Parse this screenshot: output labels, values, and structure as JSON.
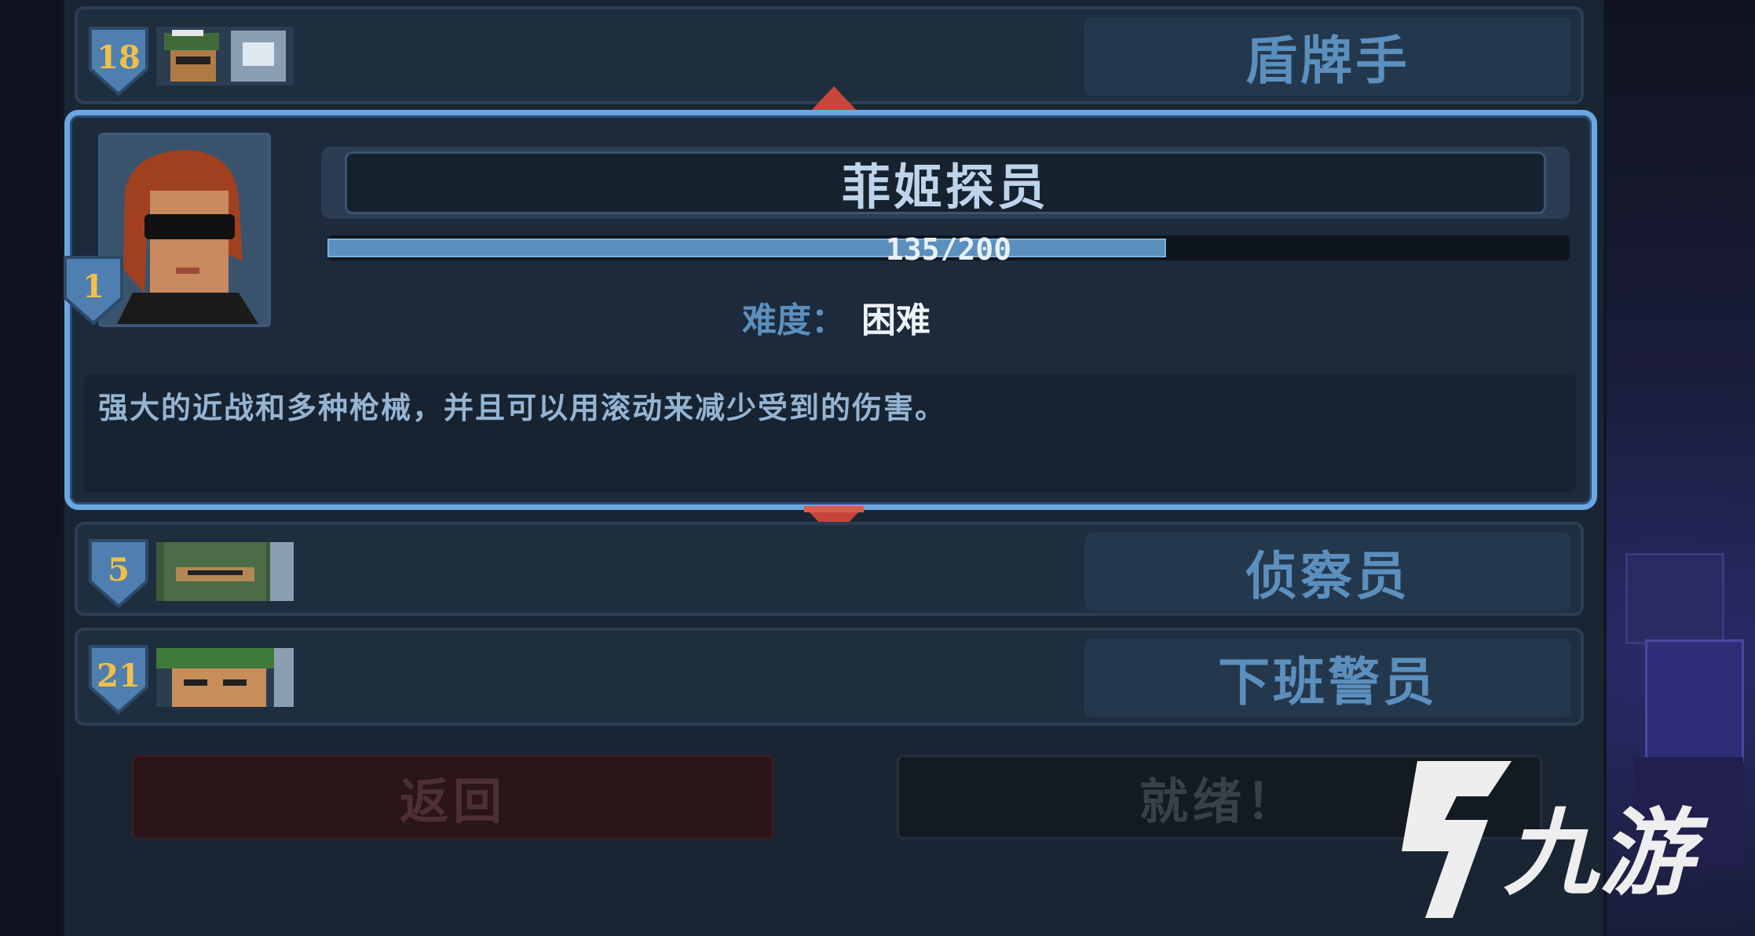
{
  "roster": [
    {
      "level": "18",
      "name": "盾牌手"
    },
    {
      "level": "5",
      "name": "侦察员"
    },
    {
      "level": "21",
      "name": "下班警员"
    }
  ],
  "selected": {
    "level": "1",
    "name": "菲姬探员",
    "xp_text": "135/200",
    "xp_fraction": 0.675,
    "difficulty_label": "难度：",
    "difficulty_value": "困难",
    "description": "强大的近战和多种枪械，并且可以用滚动来减少受到的伤害。"
  },
  "buttons": {
    "back": "返回",
    "ready": "就绪！"
  },
  "watermark": {
    "text": "九游"
  },
  "colors": {
    "accent": "#5b8fbd",
    "selected_border": "#6ba7e0",
    "arrow": "#c8453c",
    "level_number": "#f0c04a"
  }
}
